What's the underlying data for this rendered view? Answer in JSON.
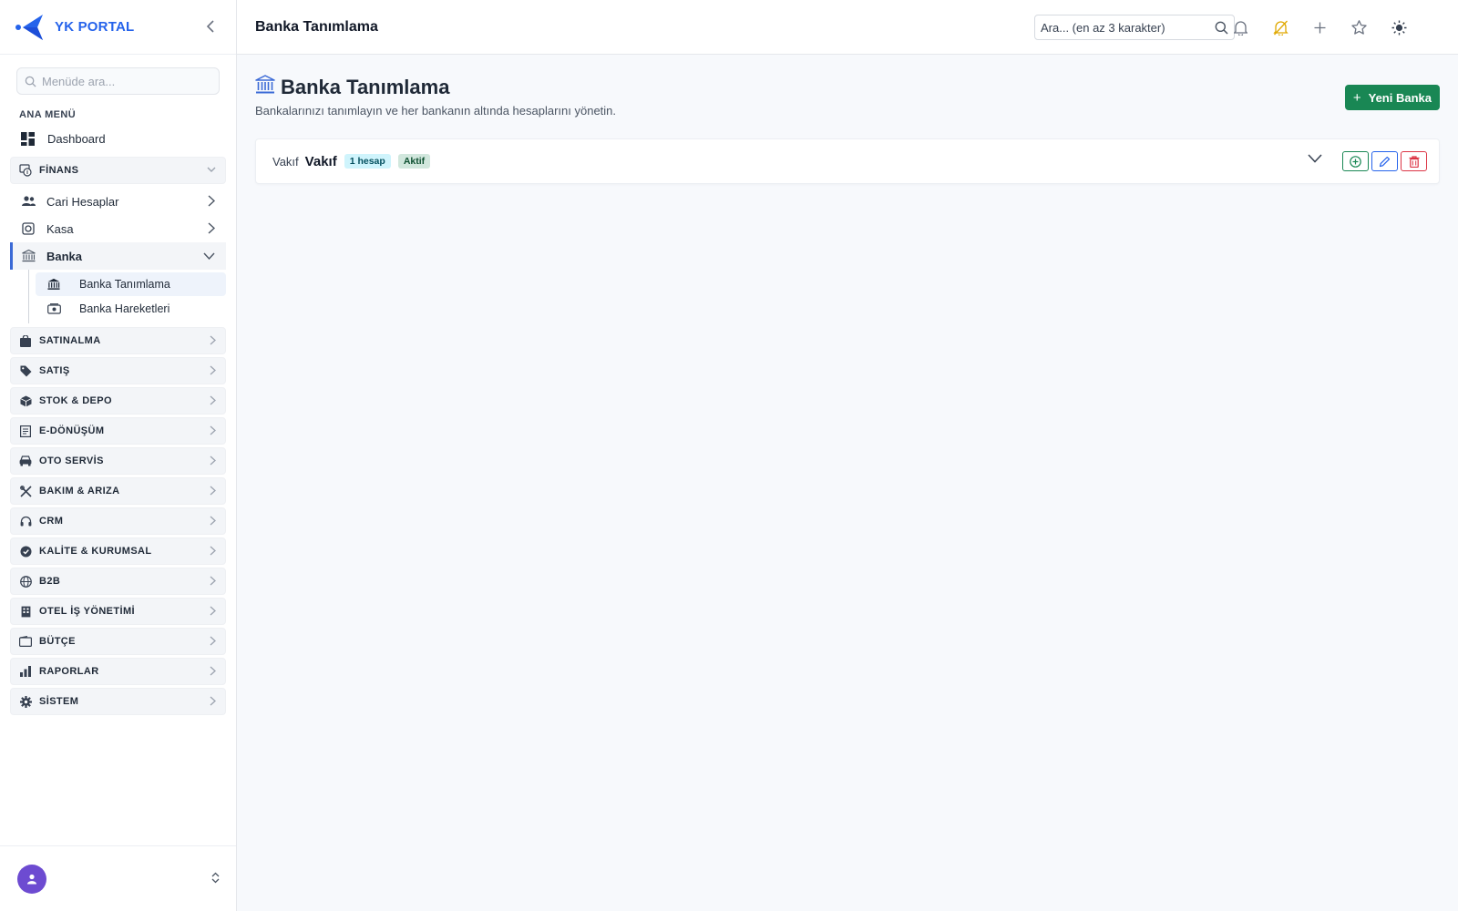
{
  "brand": {
    "name": "YK PORTAL"
  },
  "sidebar": {
    "search_placeholder": "Menüde ara...",
    "section_label": "ANA MENÜ",
    "dashboard": "Dashboard",
    "finance_group": "FİNANS",
    "finance_items": [
      "Cari Hesaplar",
      "Kasa",
      "Banka"
    ],
    "bank_subitems": [
      "Banka Tanımlama",
      "Banka Hareketleri"
    ],
    "groups": [
      "SATINALMA",
      "SATIŞ",
      "STOK & DEPO",
      "E-DÖNÜŞÜM",
      "OTO SERVİS",
      "BAKIM & ARIZA",
      "CRM",
      "KALİTE & KURUMSAL",
      "B2B",
      "OTEL İŞ YÖNETİMİ",
      "BÜTÇE",
      "RAPORLAR",
      "SİSTEM"
    ]
  },
  "topbar": {
    "title": "Banka Tanımlama",
    "search_placeholder": "Ara... (en az 3 karakter)"
  },
  "page": {
    "title": "Banka Tanımlama",
    "subtitle": "Bankalarınızı tanımlayın ve her bankanın altında hesaplarını yönetin.",
    "new_button": "Yeni Banka"
  },
  "banks": [
    {
      "short": "Vakıf",
      "name": "Vakıf",
      "accounts_badge": "1 hesap",
      "status_badge": "Aktif"
    }
  ],
  "colors": {
    "accent": "#2563eb",
    "success": "#198754",
    "danger": "#dc3545",
    "avatar": "#6d4bd1"
  }
}
